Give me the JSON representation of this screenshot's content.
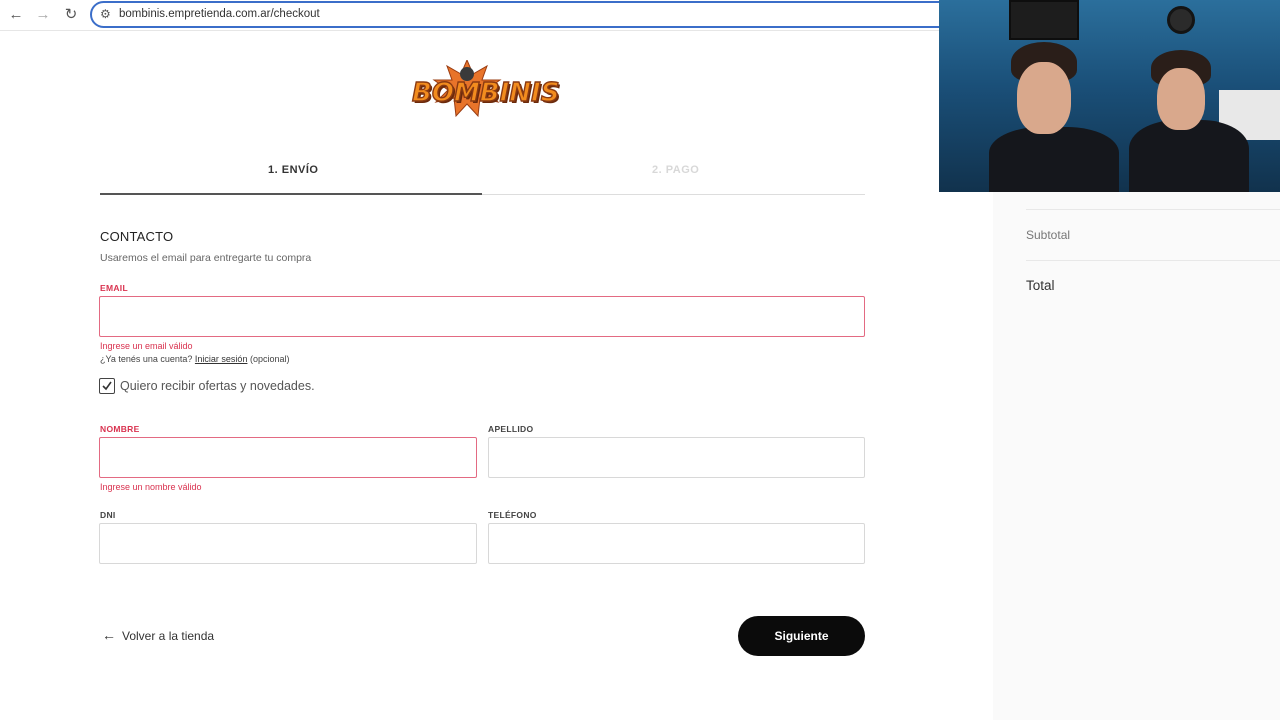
{
  "browser": {
    "url": "bombinis.empretienda.com.ar/checkout",
    "back_icon": "arrow-left-icon",
    "forward_icon": "arrow-right-icon",
    "reload_icon": "reload-icon"
  },
  "brand": {
    "logo_text": "BOMBINIS",
    "accent": "#f28c1e"
  },
  "steps": [
    {
      "label": "1. ENVÍO",
      "active": true
    },
    {
      "label": "2. PAGO",
      "active": false
    }
  ],
  "contact": {
    "title": "CONTACTO",
    "subtitle": "Usaremos el email para entregarte tu compra",
    "email_label": "EMAIL",
    "email_value": "",
    "email_error": "Ingrese un email válido",
    "account_prompt": "¿Ya tenés una cuenta?",
    "login_link": "Iniciar sesión",
    "optional": "(opcional)",
    "newsletter_label": "Quiero recibir ofertas y novedades.",
    "newsletter_checked": true
  },
  "fields": {
    "nombre_label": "NOMBRE",
    "nombre_error": "Ingrese un nombre válido",
    "apellido_label": "APELLIDO",
    "dni_label": "DNI",
    "telefono_label": "TELÉFONO"
  },
  "actions": {
    "back_label": "Volver a la tienda",
    "next_label": "Siguiente"
  },
  "summary": {
    "subtotal_label": "Subtotal",
    "total_label": "Total"
  },
  "colors": {
    "error": "#d9324f",
    "primary_button": "#0b0b0b",
    "url_focus": "#3b6ec9"
  }
}
